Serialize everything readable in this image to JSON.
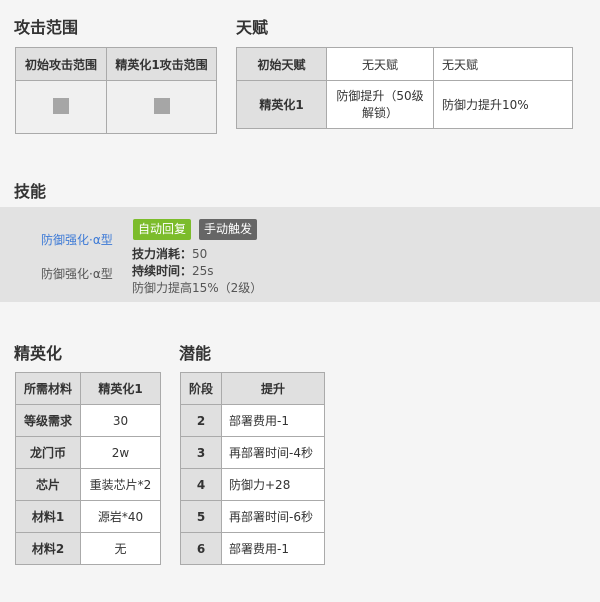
{
  "range_section": {
    "title": "攻击范围",
    "headers": [
      "初始攻击范围",
      "精英化1攻击范围"
    ]
  },
  "talent_section": {
    "title": "天赋",
    "rows": [
      {
        "label": "初始天赋",
        "cells": [
          "无天赋",
          "无天赋"
        ]
      },
      {
        "label": "精英化1",
        "cells": [
          "防御提升（50级解锁）",
          "防御力提升10%"
        ]
      }
    ]
  },
  "skill_section": {
    "title": "技能",
    "name_link": "防御强化·α型",
    "name_plain": "防御强化·α型",
    "tags": {
      "recovery": "自动回复",
      "trigger": "手动触发"
    },
    "sp_cost_label": "技力消耗：",
    "sp_cost_value": "50",
    "duration_label": "持续时间：",
    "duration_value": "25s",
    "effect": "防御力提高15%（2级）",
    "colors": {
      "link": "#3d7ad6",
      "recovery_tag": "#7cbc2b",
      "trigger_tag": "#666666"
    }
  },
  "elite_section": {
    "title": "精英化",
    "headers": [
      "所需材料",
      "精英化1"
    ],
    "rows": [
      {
        "label": "等级需求",
        "value": "30"
      },
      {
        "label": "龙门币",
        "value": "2w"
      },
      {
        "label": "芯片",
        "value": "重装芯片*2"
      },
      {
        "label": "材料1",
        "value": "源岩*40"
      },
      {
        "label": "材料2",
        "value": "无"
      }
    ]
  },
  "potential_section": {
    "title": "潜能",
    "headers": [
      "阶段",
      "提升"
    ],
    "rows": [
      {
        "stage": "2",
        "bonus": "部署费用-1"
      },
      {
        "stage": "3",
        "bonus": "再部署时间-4秒"
      },
      {
        "stage": "4",
        "bonus": "防御力+28"
      },
      {
        "stage": "5",
        "bonus": "再部署时间-6秒"
      },
      {
        "stage": "6",
        "bonus": "部署费用-1"
      }
    ]
  }
}
